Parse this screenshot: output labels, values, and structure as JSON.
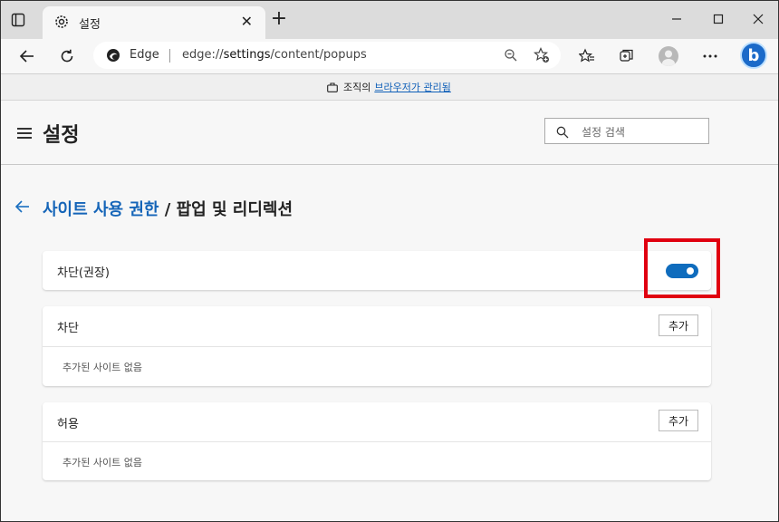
{
  "browser": {
    "tab_title": "설정",
    "new_tab_symbol": "+",
    "close_symbol": "✕",
    "site_label": "Edge",
    "url_prefix": "edge://",
    "url_bold": "settings",
    "url_rest": "/content/popups"
  },
  "managed_bar": {
    "prefix": "조직의",
    "link": "브라우저가 관리됨"
  },
  "settings": {
    "title": "설정",
    "search_placeholder": "설정 검색"
  },
  "breadcrumb": {
    "parent": "사이트 사용 권한",
    "separator": " / ",
    "current": "팝업 및 리디렉션"
  },
  "block_recommended": {
    "label": "차단(권장)",
    "toggle_on": true,
    "accent": "#0f6cbd"
  },
  "block_section": {
    "label": "차단",
    "add_label": "추가",
    "empty_text": "추가된 사이트 없음"
  },
  "allow_section": {
    "label": "허용",
    "add_label": "추가",
    "empty_text": "추가된 사이트 없음"
  },
  "highlight_color": "#e00010"
}
